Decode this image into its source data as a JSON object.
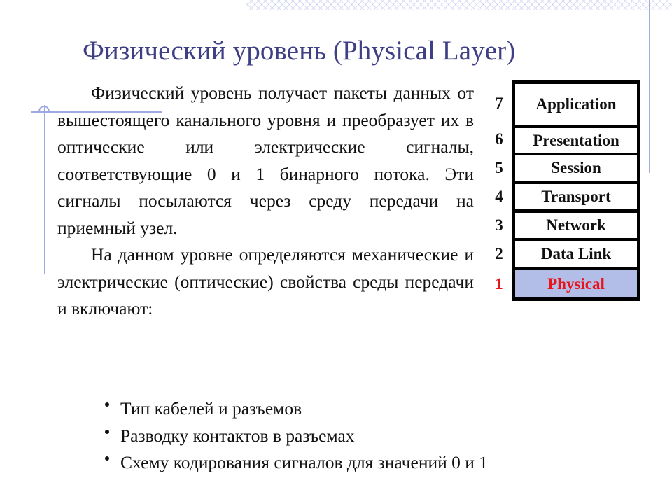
{
  "slide": {
    "title": "Физический уровень (Physical Layer)",
    "paragraphs": [
      "Физический уровень получает пакеты данных от вышестоящего канального уровня и преобразует их в оптические или электрические сигналы, соответствующие 0 и 1 бинарного потока. Эти сигналы посылаются через среду передачи на приемный узел.",
      "На данном уровне определяются механические и электрические (оптические) свойства среды передачи и включают:"
    ],
    "bullets": [
      "Тип кабелей и разъемов",
      "Разводку контактов в разъемах",
      "Схему кодирования сигналов для значений 0 и 1"
    ]
  },
  "osi_model": {
    "highlighted_layer": 1,
    "highlight_color": "#b3bee8",
    "highlight_text_color": "#e8141c",
    "layers": [
      {
        "number": "7",
        "name": "Application"
      },
      {
        "number": "6",
        "name": "Presentation"
      },
      {
        "number": "5",
        "name": "Session"
      },
      {
        "number": "4",
        "name": "Transport"
      },
      {
        "number": "3",
        "name": "Network"
      },
      {
        "number": "2",
        "name": "Data Link"
      },
      {
        "number": "1",
        "name": "Physical"
      }
    ]
  },
  "theme": {
    "title_color": "#3f3f86",
    "accent_line_color": "#9fa9e2"
  }
}
